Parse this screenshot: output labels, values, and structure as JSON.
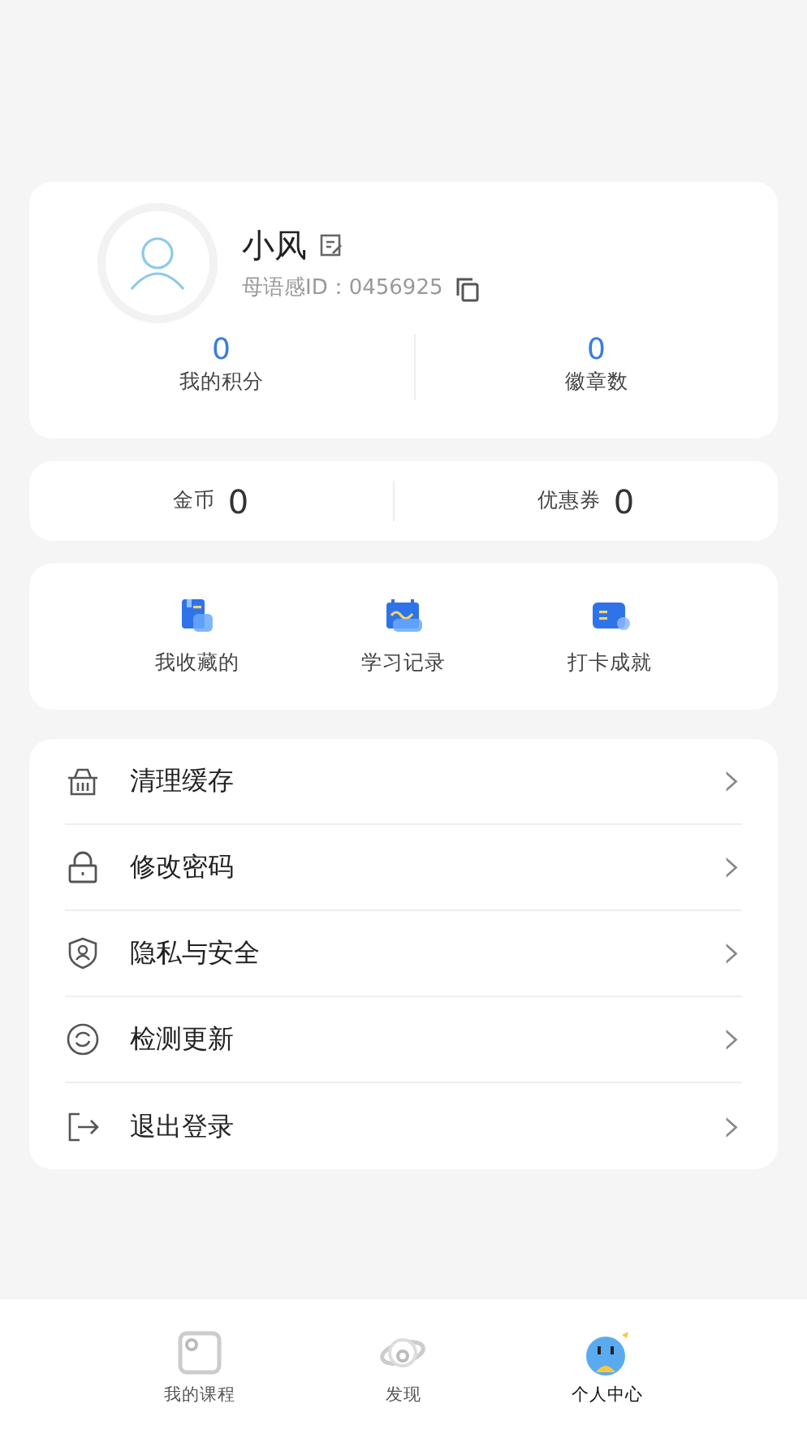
{
  "profile": {
    "name": "小风",
    "id_label": "母语感ID：0456925"
  },
  "stats": [
    {
      "value": "0",
      "label": "我的积分"
    },
    {
      "value": "0",
      "label": "徽章数"
    }
  ],
  "wallet": [
    {
      "label": "金币",
      "value": "0"
    },
    {
      "label": "优惠券",
      "value": "0"
    }
  ],
  "shortcuts": [
    {
      "label": "我收藏的"
    },
    {
      "label": "学习记录"
    },
    {
      "label": "打卡成就"
    }
  ],
  "menu": [
    {
      "label": "清理缓存",
      "chevron": "›"
    },
    {
      "label": "修改密码",
      "chevron": "›"
    },
    {
      "label": "隐私与安全",
      "chevron": "›"
    },
    {
      "label": "检测更新",
      "chevron": "›"
    },
    {
      "label": "退出登录",
      "chevron": "›"
    }
  ],
  "tabs": [
    {
      "label": "我的课程",
      "selected": false
    },
    {
      "label": "发现",
      "selected": false
    },
    {
      "label": "个人中心",
      "selected": true
    }
  ]
}
